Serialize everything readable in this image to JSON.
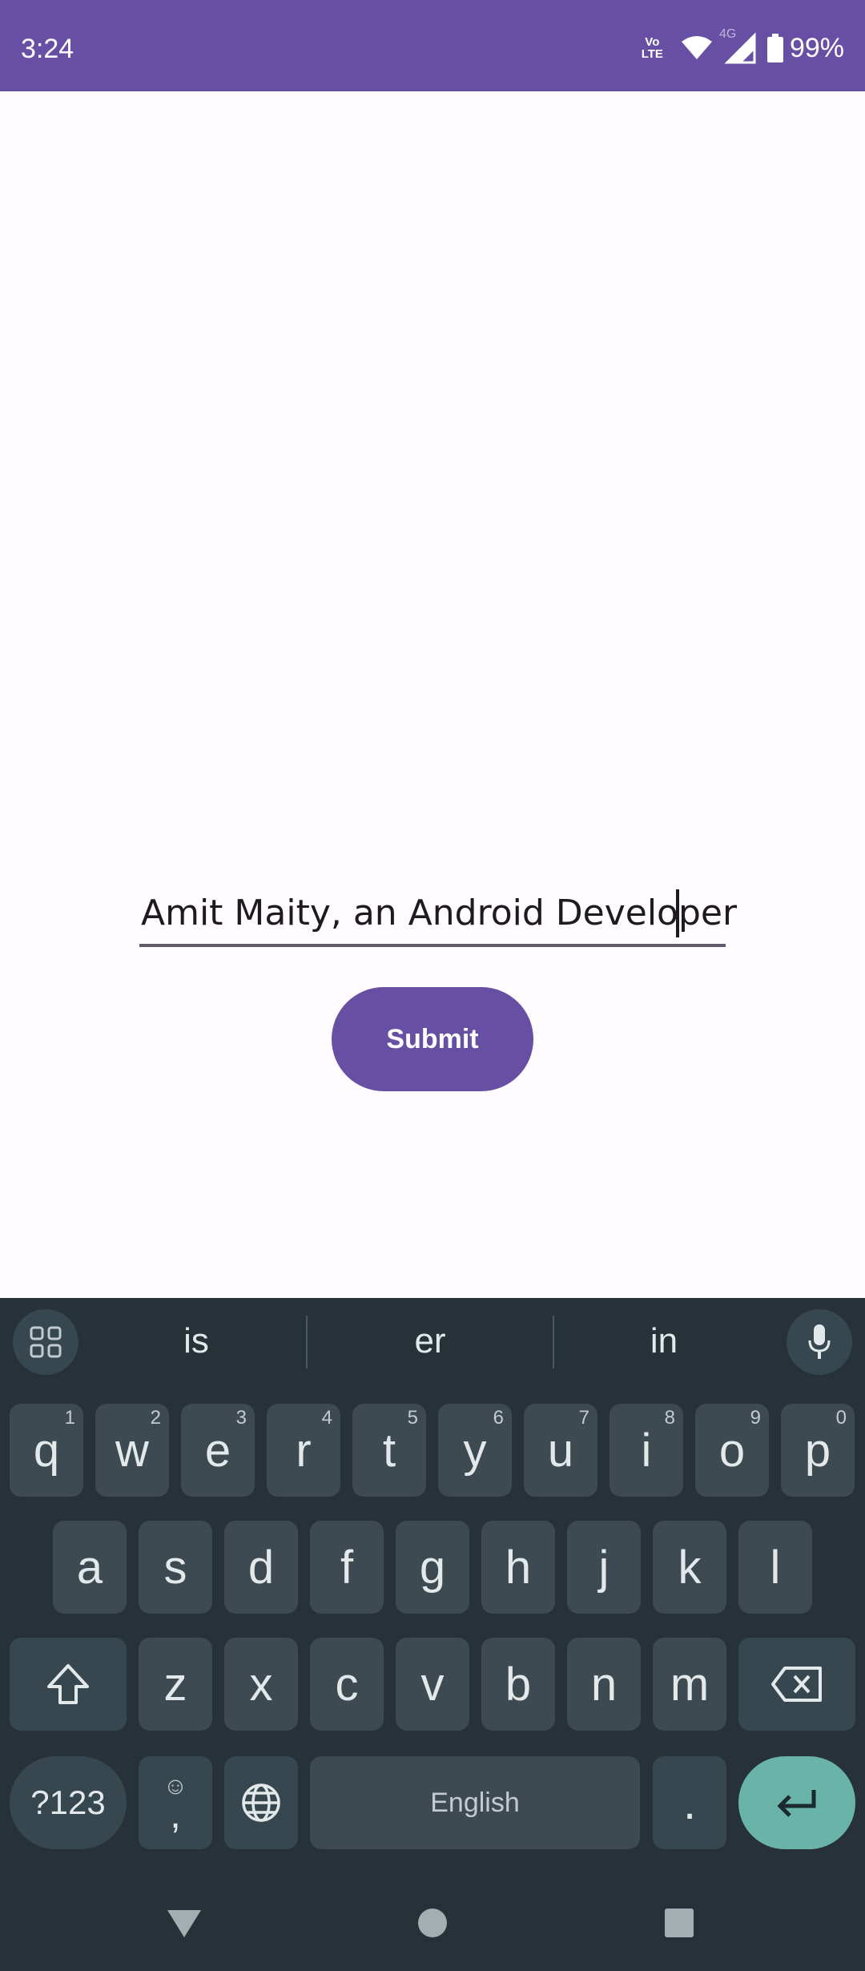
{
  "status_bar": {
    "time": "3:24",
    "volte_line1": "Vo",
    "volte_line2": "LTE",
    "network_label": "4G",
    "battery_percent": "99%",
    "icons": [
      "volte-icon",
      "wifi-icon",
      "signal-icon",
      "battery-icon"
    ],
    "color": "#6750A4"
  },
  "form": {
    "text_value": "Amit Maity, an Android Developer",
    "submit_label": "Submit"
  },
  "keyboard": {
    "suggestions": [
      "is",
      "er",
      "in"
    ],
    "row1": [
      {
        "key": "q",
        "hint": "1"
      },
      {
        "key": "w",
        "hint": "2"
      },
      {
        "key": "e",
        "hint": "3"
      },
      {
        "key": "r",
        "hint": "4"
      },
      {
        "key": "t",
        "hint": "5"
      },
      {
        "key": "y",
        "hint": "6"
      },
      {
        "key": "u",
        "hint": "7"
      },
      {
        "key": "i",
        "hint": "8"
      },
      {
        "key": "o",
        "hint": "9"
      },
      {
        "key": "p",
        "hint": "0"
      }
    ],
    "row2": [
      "a",
      "s",
      "d",
      "f",
      "g",
      "h",
      "j",
      "k",
      "l"
    ],
    "row3": [
      "z",
      "x",
      "c",
      "v",
      "b",
      "n",
      "m"
    ],
    "symbols_label": "?123",
    "emoji_symbol": "☺",
    "comma_label": ",",
    "space_label": "English",
    "period_label": ".",
    "enter_color": "#69B3A9"
  }
}
